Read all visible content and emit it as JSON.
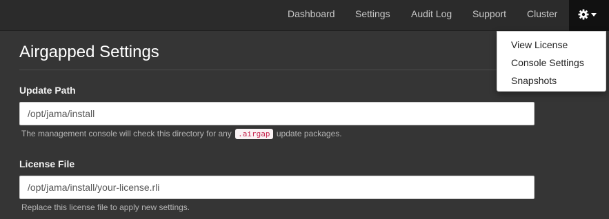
{
  "nav": {
    "items": [
      "Dashboard",
      "Settings",
      "Audit Log",
      "Support",
      "Cluster"
    ],
    "gear_icon": "gear-icon"
  },
  "dropdown": {
    "items": [
      "View License",
      "Console Settings",
      "Snapshots"
    ]
  },
  "page": {
    "title": "Airgapped Settings"
  },
  "fields": {
    "update_path": {
      "label": "Update Path",
      "value": "/opt/jama/install",
      "help_before": "The management console will check this directory for any",
      "help_code": ".airgap",
      "help_after": "update packages."
    },
    "license_file": {
      "label": "License File",
      "value": "/opt/jama/install/your-license.rli",
      "help": "Replace this license file to apply new settings."
    }
  },
  "colors": {
    "navbar": "#2b2b2b",
    "background": "#353535",
    "code_text": "#c7254e"
  }
}
